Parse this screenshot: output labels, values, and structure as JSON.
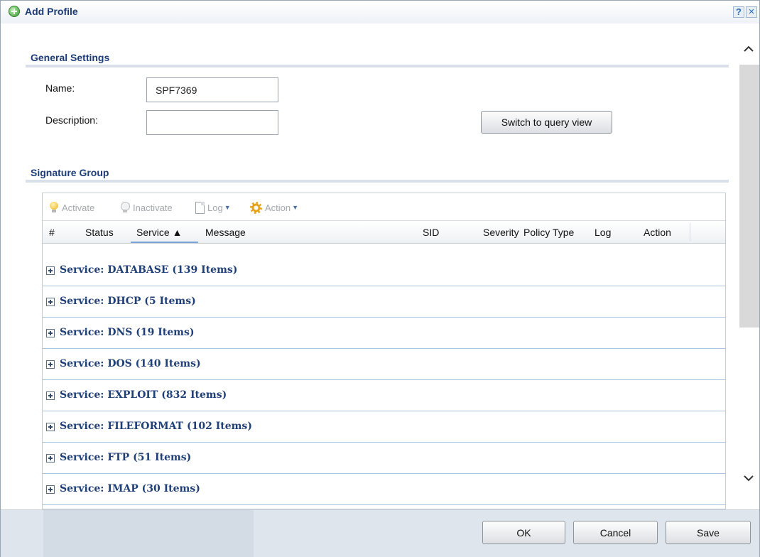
{
  "dialog": {
    "title": "Add Profile",
    "help_label": "?",
    "close_label": "×"
  },
  "general": {
    "title": "General Settings",
    "name_label": "Name:",
    "name_value": "SPF7369",
    "description_label": "Description:",
    "description_value": "",
    "switch_label": "Switch to query view"
  },
  "signature": {
    "title": "Signature Group",
    "toolbar": {
      "activate": "Activate",
      "inactivate": "Inactivate",
      "log": "Log",
      "action": "Action"
    },
    "columns": {
      "num": "#",
      "status": "Status",
      "service": "Service ▲",
      "message": "Message",
      "sid": "SID",
      "severity": "Severity",
      "policy_type": "Policy Type",
      "log": "Log",
      "action": "Action"
    },
    "groups": [
      "Service: DATABASE (139 Items)",
      "Service: DHCP (5 Items)",
      "Service: DNS (19 Items)",
      "Service: DOS (140 Items)",
      "Service: EXPLOIT (832 Items)",
      "Service: FILEFORMAT (102 Items)",
      "Service: FTP (51 Items)",
      "Service: IMAP (30 Items)"
    ]
  },
  "footer": {
    "ok": "OK",
    "cancel": "Cancel",
    "save": "Save"
  }
}
